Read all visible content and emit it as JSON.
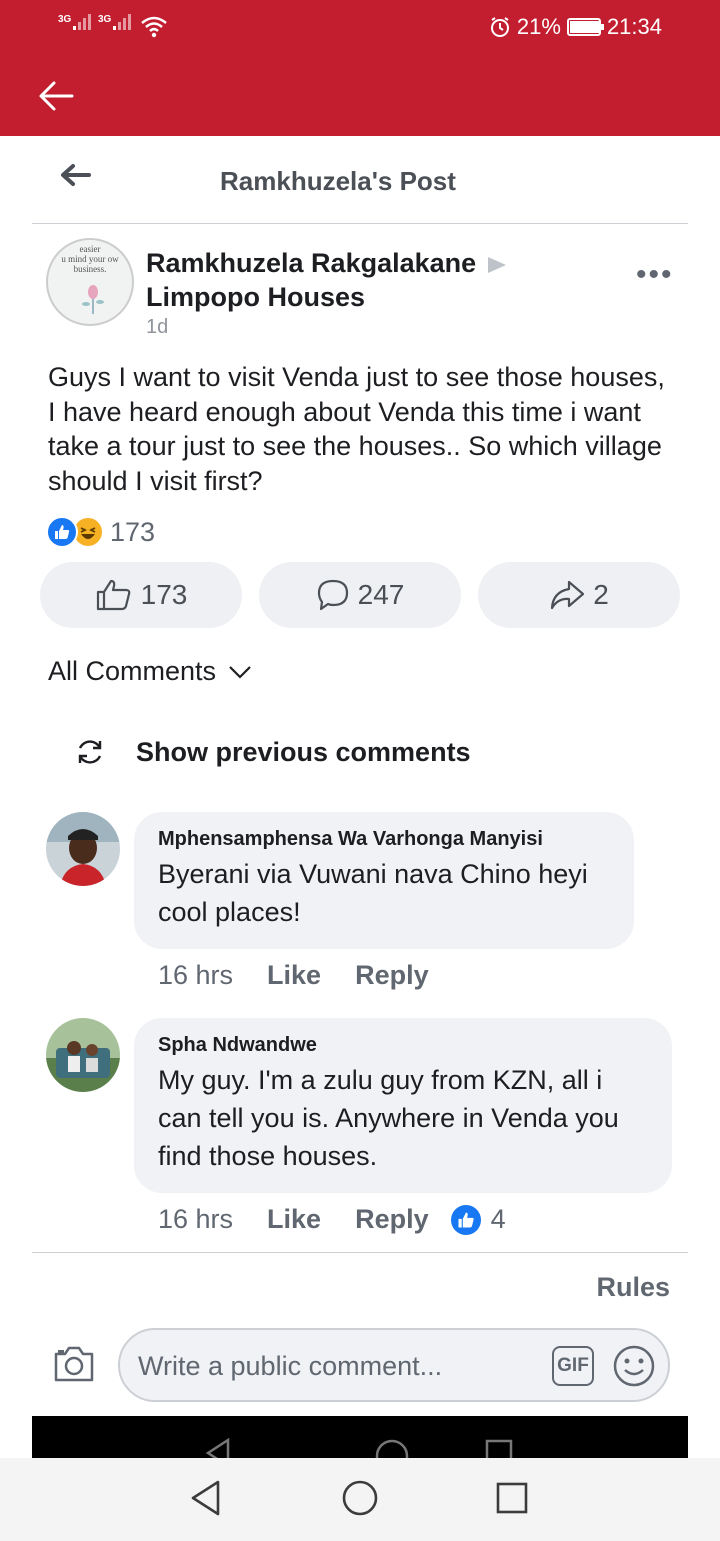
{
  "status_bar": {
    "signal_1_tag": "3G",
    "signal_2_tag": "3G",
    "battery_percent": "21%",
    "time": "21:34"
  },
  "post_header": {
    "title": "Ramkhuzela's Post"
  },
  "post": {
    "avatar_text": "easier\nu mind your ow\nbusiness.",
    "author": "Ramkhuzela Rakgalakane",
    "group": "Limpopo Houses",
    "time": "1d",
    "text": "Guys I want to visit Venda just to see those houses, I have heard enough about Venda this time i want take a tour just to see the houses.. So which village should I visit first?",
    "reaction_count": "173",
    "like_count": "173",
    "comment_count": "247",
    "share_count": "2"
  },
  "comments_section": {
    "filter_label": "All Comments",
    "show_previous_label": "Show previous comments",
    "rules_label": "Rules"
  },
  "comments": [
    {
      "name": "Mphensamphensa Wa Varhonga Manyisi",
      "text": "Byerani via Vuwani nava Chino heyi cool places!",
      "time": "16 hrs",
      "like_label": "Like",
      "reply_label": "Reply"
    },
    {
      "name": "Spha Ndwandwe",
      "text": "My guy. I'm a zulu guy from KZN, all i can tell you is. Anywhere in Venda you find those houses.",
      "time": "16 hrs",
      "like_label": "Like",
      "reply_label": "Reply",
      "reaction_count": "4"
    }
  ],
  "composer": {
    "placeholder": "Write a public comment...",
    "gif_label": "GIF"
  },
  "colors": {
    "header_red": "#c31e30",
    "facebook_blue": "#1877f2",
    "bubble_gray": "#f0f2f5"
  }
}
